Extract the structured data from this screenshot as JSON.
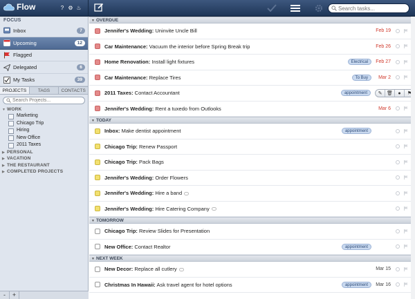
{
  "app": {
    "title": "Flow"
  },
  "topbar": {
    "icons": [
      "help-icon",
      "gear-icon",
      "bell-icon",
      "compose-icon",
      "checkmark-icon",
      "list-icon",
      "settings-icon"
    ],
    "search_placeholder": "Search tasks..."
  },
  "sidebar": {
    "focus_header": "FOCUS",
    "focus_items": [
      {
        "label": "Inbox",
        "count": "7",
        "icon": "inbox-icon",
        "selected": false
      },
      {
        "label": "Upcoming",
        "count": "12",
        "icon": "calendar-icon",
        "selected": true
      },
      {
        "label": "Flagged",
        "count": "",
        "icon": "flag-icon",
        "selected": false
      },
      {
        "label": "Delegated",
        "count": "6",
        "icon": "send-icon",
        "selected": false
      },
      {
        "label": "My Tasks",
        "count": "39",
        "icon": "checkbox-icon",
        "selected": false
      }
    ],
    "tabs": [
      "PROJECTS",
      "TAGS",
      "CONTACTS"
    ],
    "project_search_placeholder": "Search Projects...",
    "groups": [
      {
        "name": "WORK",
        "expanded": true,
        "projects": [
          "Marketing",
          "Chicago Trip",
          "Hiring",
          "New Office",
          "2011 Taxes"
        ]
      },
      {
        "name": "PERSONAL",
        "expanded": false,
        "projects": []
      },
      {
        "name": "VACATION",
        "expanded": false,
        "projects": []
      },
      {
        "name": "THE RESTAURANT",
        "expanded": false,
        "projects": []
      },
      {
        "name": "COMPLETED PROJECTS",
        "expanded": false,
        "projects": []
      }
    ],
    "footer": [
      "-",
      "+"
    ]
  },
  "sections": [
    {
      "title": "OVERDUE",
      "tasks": [
        {
          "project": "Jennifer's Wedding:",
          "text": "Uninvite Uncle Bill",
          "color": "red",
          "tag": "",
          "date": "Feb 19",
          "date_color": "red",
          "comment": false,
          "hover": false
        },
        {
          "project": "Car Maintenance:",
          "text": "Vacuum the interior before Spring Break trip",
          "color": "red",
          "tag": "",
          "date": "Feb 26",
          "date_color": "red",
          "comment": false,
          "hover": false
        },
        {
          "project": "Home Renovation:",
          "text": "Install light fixtures",
          "color": "red",
          "tag": "Electrical",
          "date": "Feb 27",
          "date_color": "red",
          "comment": false,
          "hover": false
        },
        {
          "project": "Car Maintenance:",
          "text": "Replace Tires",
          "color": "red",
          "tag": "To Buy",
          "date": "Mar 2",
          "date_color": "red",
          "comment": false,
          "hover": false
        },
        {
          "project": "2011 Taxes:",
          "text": "Contact Accountant",
          "color": "red",
          "tag": "appointment",
          "date": "Mar 4",
          "date_color": "red",
          "comment": false,
          "hover": true
        },
        {
          "project": "Jennifer's Wedding:",
          "text": "Rent a tuxedo from Outlooks",
          "color": "red",
          "tag": "",
          "date": "Mar 6",
          "date_color": "red",
          "comment": false,
          "hover": false
        }
      ]
    },
    {
      "title": "TODAY",
      "tasks": [
        {
          "project": "Inbox:",
          "text": "Make dentist appointment",
          "color": "yel",
          "tag": "appointment",
          "date": "",
          "date_color": "gray",
          "comment": false,
          "hover": false
        },
        {
          "project": "Chicago Trip:",
          "text": "Renew Passport",
          "color": "yel",
          "tag": "",
          "date": "",
          "date_color": "gray",
          "comment": false,
          "hover": false
        },
        {
          "project": "Chicago Trip:",
          "text": "Pack Bags",
          "color": "yel",
          "tag": "",
          "date": "",
          "date_color": "gray",
          "comment": false,
          "hover": false
        },
        {
          "project": "Jennifer's Wedding:",
          "text": "Order Flowers",
          "color": "yel",
          "tag": "",
          "date": "",
          "date_color": "gray",
          "comment": false,
          "hover": false
        },
        {
          "project": "Jennifer's Wedding:",
          "text": "Hire a band",
          "color": "yel",
          "tag": "",
          "date": "",
          "date_color": "gray",
          "comment": true,
          "hover": false
        },
        {
          "project": "Jennifer's Wedding:",
          "text": "Hire Catering Company",
          "color": "yel",
          "tag": "",
          "date": "",
          "date_color": "gray",
          "comment": true,
          "hover": false
        }
      ]
    },
    {
      "title": "TOMORROW",
      "tasks": [
        {
          "project": "Chicago Trip:",
          "text": "Review Slides for Presentation",
          "color": "wht",
          "tag": "",
          "date": "",
          "date_color": "gray",
          "comment": false,
          "hover": false
        },
        {
          "project": "New Office:",
          "text": "Contact Realtor",
          "color": "wht",
          "tag": "appointment",
          "date": "",
          "date_color": "gray",
          "comment": false,
          "hover": false
        }
      ]
    },
    {
      "title": "NEXT WEEK",
      "tasks": [
        {
          "project": "New Decor:",
          "text": "Replace all cutlery",
          "color": "wht",
          "tag": "",
          "date": "Mar 15",
          "date_color": "gray",
          "comment": true,
          "hover": false
        },
        {
          "project": "Christmas In Hawaii:",
          "text": "Ask travel agent for hotel options",
          "color": "wht",
          "tag": "appointment",
          "date": "Mar 16",
          "date_color": "gray",
          "comment": false,
          "hover": false
        }
      ]
    }
  ],
  "hover_tools": [
    "edit-icon",
    "trash-icon",
    "comment-icon",
    "flag-icon"
  ]
}
